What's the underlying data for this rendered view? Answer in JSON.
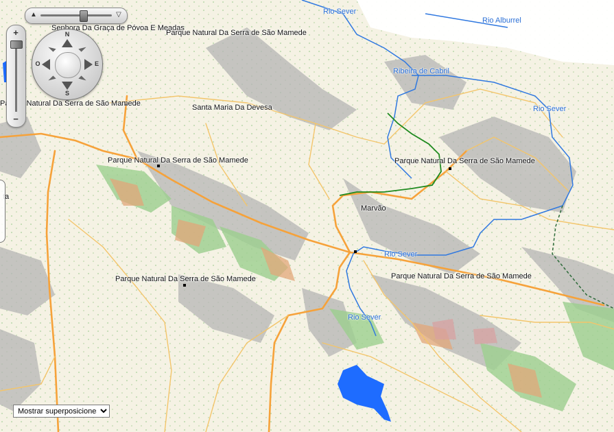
{
  "map": {
    "place_labels": [
      {
        "id": "place-senhora",
        "text": "Senhora Da Graça de Póvoa E Meadas"
      },
      {
        "id": "park-top",
        "text": "Parque Natural Da Serra de São Mamede"
      },
      {
        "id": "park-left-top",
        "text": "Parque Natural Da Serra de São Mamede"
      },
      {
        "id": "santa-maria",
        "text": "Santa Maria Da Devesa"
      },
      {
        "id": "park-center",
        "text": "Parque Natural Da Serra de São Mamede"
      },
      {
        "id": "park-right",
        "text": "Parque Natural Da Serra de São Mamede"
      },
      {
        "id": "marvao",
        "text": "Marvão"
      },
      {
        "id": "park-lower-left",
        "text": "Parque Natural Da Serra de São Mamede"
      },
      {
        "id": "park-lower-right",
        "text": "Parque Natural Da Serra de São Mamede"
      },
      {
        "id": "edge-left",
        "text": "ta"
      }
    ],
    "river_labels": [
      {
        "id": "rio-sever-top",
        "text": "Rio Sever"
      },
      {
        "id": "rio-alburrel",
        "text": "Rio Alburrel"
      },
      {
        "id": "ribeira-cabril",
        "text": "Ribeira de Cabril"
      },
      {
        "id": "rio-sever-right",
        "text": "Rio Sever"
      },
      {
        "id": "rio-sever-mid",
        "text": "Rio Sever"
      },
      {
        "id": "rio-sever-low",
        "text": "Rio Sever"
      }
    ]
  },
  "compass": {
    "n": "N",
    "s": "S",
    "e": "E",
    "w": "O"
  },
  "zoom": {
    "plus": "+",
    "minus": "−",
    "tilt_up": "▲",
    "tilt_down": "▽"
  },
  "overlay": {
    "selected": "Mostrar superposiciones"
  },
  "colors": {
    "water": "#1e6cff",
    "river": "#2f78e0",
    "road_major": "#f6a23a",
    "road_minor": "#f3c56b",
    "border_green": "#1f8a1f",
    "terrain_gray": "#b9b9b9",
    "vegetation": "#8fcf8f"
  }
}
